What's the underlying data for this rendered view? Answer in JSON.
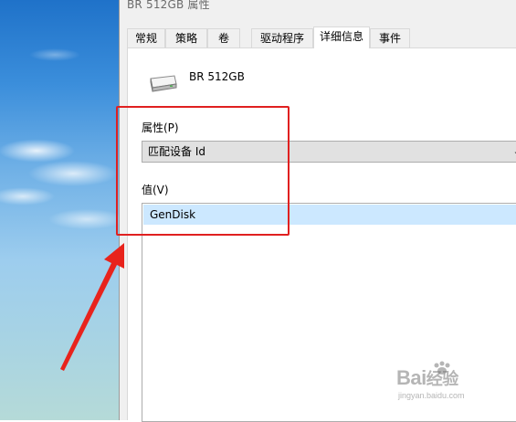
{
  "window": {
    "title": "BR 512GB 属性"
  },
  "tabs": [
    {
      "label": "常规"
    },
    {
      "label": "策略"
    },
    {
      "label": "卷"
    },
    {
      "label": "驱动程序"
    },
    {
      "label": "详细信息"
    },
    {
      "label": "事件"
    }
  ],
  "active_tab": "详细信息",
  "device": {
    "name": "BR 512GB",
    "icon": "drive-icon"
  },
  "property": {
    "label": "属性(P)",
    "selected": "匹配设备 Id"
  },
  "value": {
    "label": "值(V)",
    "items": [
      "GenDisk"
    ]
  },
  "annotation": {
    "color": "#e02020"
  },
  "watermark": {
    "brand": "Bai",
    "brand_cn": "经验",
    "sub": "jingyan.baidu.com"
  }
}
